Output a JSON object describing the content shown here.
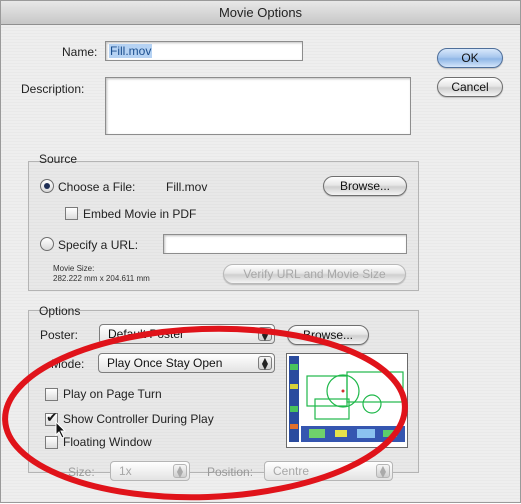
{
  "window": {
    "title": "Movie Options"
  },
  "name_field": {
    "label": "Name:",
    "value": "Fill.mov"
  },
  "description_field": {
    "label": "Description:",
    "value": ""
  },
  "buttons": {
    "ok": "OK",
    "cancel": "Cancel"
  },
  "source": {
    "title": "Source",
    "choose_file": {
      "label": "Choose a File:",
      "filename": "Fill.mov",
      "selected": true
    },
    "browse": "Browse...",
    "embed": {
      "label": "Embed Movie in PDF",
      "checked": false
    },
    "specify_url": {
      "label": "Specify a URL:",
      "value": "",
      "selected": false
    },
    "movie_size": {
      "label": "Movie Size:",
      "value": "282.222 mm x 204.611 mm"
    },
    "verify": "Verify URL and Movie Size"
  },
  "options": {
    "title": "Options",
    "poster": {
      "label": "Poster:",
      "value": "Default Poster"
    },
    "browse": "Browse...",
    "mode": {
      "label": "Mode:",
      "value": "Play Once Stay Open"
    },
    "play_on_page_turn": {
      "label": "Play on Page Turn",
      "checked": false
    },
    "show_controller": {
      "label": "Show Controller During Play",
      "checked": true
    },
    "floating_window": {
      "label": "Floating Window",
      "checked": false
    },
    "size": {
      "label": "Size:",
      "value": "1x"
    },
    "position": {
      "label": "Position:",
      "value": "Centre"
    }
  },
  "annotation": {
    "color": "#e0131a",
    "shape": "ellipse"
  },
  "colors": {
    "selection": "#b5d2f3",
    "preview_accent": "#1fb84a"
  }
}
